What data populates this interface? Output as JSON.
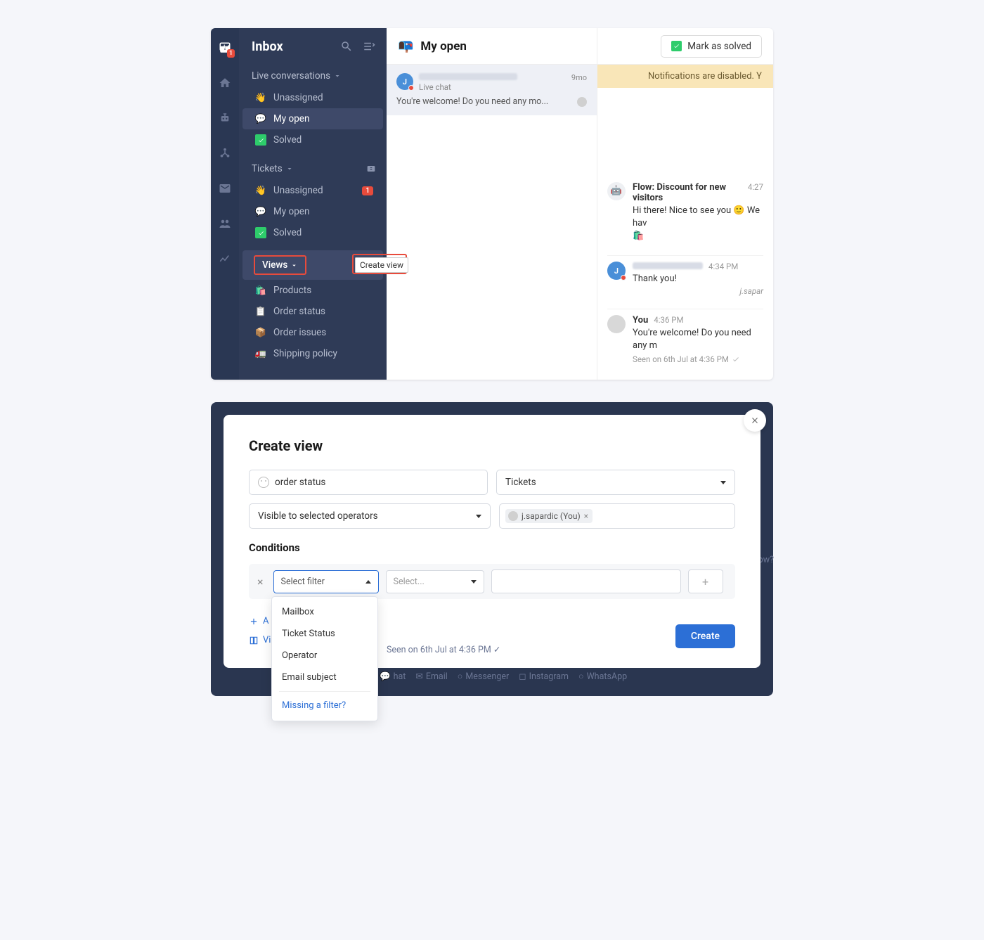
{
  "sidebar": {
    "title": "Inbox",
    "rail_badge": "1",
    "sections": {
      "live": {
        "label": "Live conversations",
        "items": [
          {
            "label": "Unassigned",
            "icon": "👋"
          },
          {
            "label": "My open",
            "icon": "💬",
            "active": true
          },
          {
            "label": "Solved",
            "icon": "check"
          }
        ]
      },
      "tickets": {
        "label": "Tickets",
        "items": [
          {
            "label": "Unassigned",
            "icon": "👋",
            "badge": "1"
          },
          {
            "label": "My open",
            "icon": "💬"
          },
          {
            "label": "Solved",
            "icon": "check"
          }
        ]
      },
      "views": {
        "label": "Views",
        "tooltip": "Create view",
        "items": [
          {
            "label": "Products",
            "icon": "🛍️"
          },
          {
            "label": "Order status",
            "icon": "📋"
          },
          {
            "label": "Order issues",
            "icon": "📦"
          },
          {
            "label": "Shipping policy",
            "icon": "🚛"
          }
        ]
      }
    }
  },
  "center": {
    "title": "My open",
    "conversation": {
      "avatar_letter": "J",
      "sub": "Live chat",
      "time": "9mo",
      "preview": "You're welcome! Do you need any mo..."
    }
  },
  "right": {
    "solved_btn": "Mark as solved",
    "banner": "Notifications are disabled. Y",
    "messages": {
      "flow": {
        "name": "Flow: Discount for new visitors",
        "time": "4:27",
        "text": "Hi there! Nice to see you 🙂 We hav",
        "emoji": "🛍️"
      },
      "user": {
        "avatar_letter": "J",
        "time": "4:34 PM",
        "text": "Thank you!",
        "sig": "j.sapar"
      },
      "you": {
        "name": "You",
        "time": "4:36 PM",
        "text": "You're welcome! Do you need any m",
        "seen": "Seen on 6th Jul at 4:36 PM"
      }
    }
  },
  "modal": {
    "title": "Create view",
    "name_input": "order status",
    "type_select": "Tickets",
    "visibility_select": "Visible to selected operators",
    "operator_chip": "j.sapardic (You)",
    "conditions_label": "Conditions",
    "filter_placeholder": "Select filter",
    "operator_placeholder": "Select...",
    "dropdown": [
      "Mailbox",
      "Ticket Status",
      "Operator",
      "Email subject"
    ],
    "dropdown_footer": "Missing a filter?",
    "add_link": "A",
    "view_link": "Vi",
    "create_btn": "Create"
  },
  "bg": {
    "seen": "Seen on 6th Jul at 4:36 PM ✓",
    "right_text": "me now?",
    "channels": [
      "hat",
      "Email",
      "Messenger",
      "Instagram",
      "WhatsApp"
    ]
  }
}
